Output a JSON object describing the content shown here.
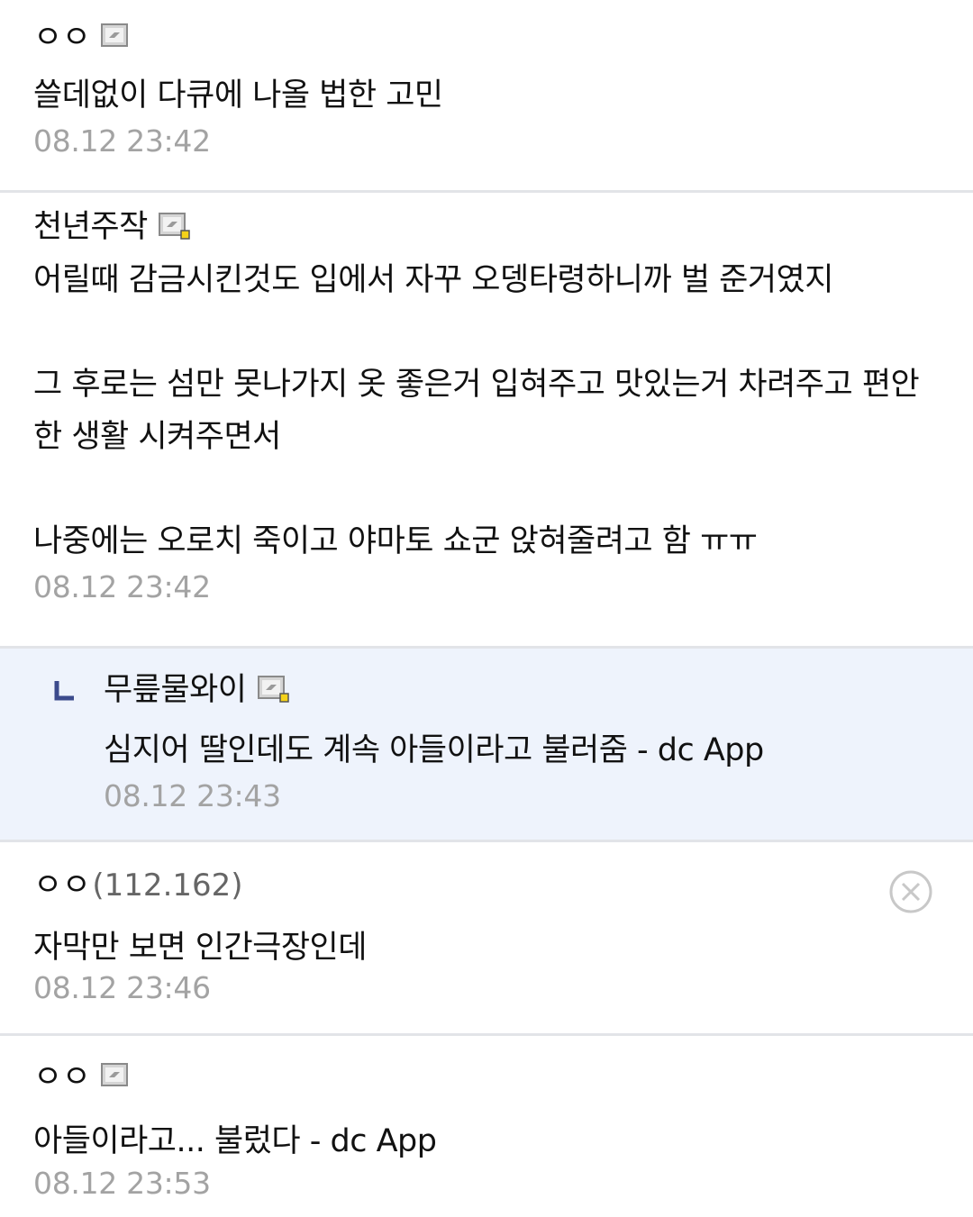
{
  "comments": [
    {
      "nick": "ㅇㅇ",
      "text": "쓸데없이 다큐에 나올 법한 고민",
      "time": "08.12 23:42"
    },
    {
      "nick": "천년주작",
      "text": "어릴때 감금시킨것도 입에서 자꾸 오뎅타령하니까 벌 준거였지\n\n그 후로는 섬만 못나가지 옷 좋은거 입혀주고 맛있는거 차려주고 편안한 생활 시켜주면서\n\n나중에는 오로치 죽이고 야마토 쇼군 앉혀줄려고 함 ㅠㅠ",
      "time": "08.12 23:42"
    },
    {
      "nick": "무릎물와이",
      "text": "심지어 딸인데도 계속 아들이라고 불러줌 - dc App",
      "time": "08.12 23:43"
    },
    {
      "nick": "ㅇㅇ",
      "ip": "(112.162)",
      "text": "자막만 보면 인간극장인데",
      "time": "08.12 23:46"
    },
    {
      "nick": "ㅇㅇ",
      "text": "아들이라고... 불렀다 - dc App",
      "time": "08.12 23:53"
    }
  ],
  "icons": {
    "gallog": "gallog-icon",
    "gallog_fixed": "gallog-fixed-icon",
    "reply": "reply-arrow-icon",
    "delete": "delete-icon"
  },
  "colors": {
    "reply_bg": "#eef3fc",
    "divider": "#e2e4e8",
    "time": "#a3a3a3",
    "reply_arrow": "#3b4a8c",
    "fixed_badge": "#f5d21a"
  }
}
